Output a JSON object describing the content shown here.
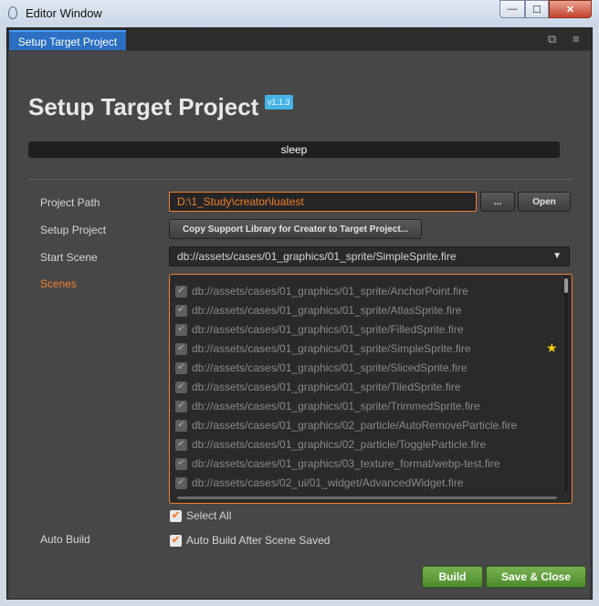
{
  "window": {
    "title": "Editor Window",
    "min_glyph": "—",
    "max_glyph": "☐",
    "close_glyph": "✕"
  },
  "tab": {
    "label": "Setup Target Project"
  },
  "header": {
    "title": "Setup Target Project",
    "version": "v1.1.3"
  },
  "status": {
    "text": "sleep"
  },
  "labels": {
    "project_path": "Project Path",
    "setup_project": "Setup Project",
    "start_scene": "Start Scene",
    "scenes": "Scenes",
    "auto_build": "Auto Build"
  },
  "project_path": {
    "value": "D:\\1_Study\\creator\\luatest",
    "browse_label": "...",
    "open_label": "Open"
  },
  "setup": {
    "button_label": "Copy Support Library for Creator to Target Project..."
  },
  "start_scene": {
    "value": "db://assets/cases/01_graphics/01_sprite/SimpleSprite.fire"
  },
  "scenes": [
    "db://assets/cases/01_graphics/01_sprite/AnchorPoint.fire",
    "db://assets/cases/01_graphics/01_sprite/AtlasSprite.fire",
    "db://assets/cases/01_graphics/01_sprite/FilledSprite.fire",
    "db://assets/cases/01_graphics/01_sprite/SimpleSprite.fire",
    "db://assets/cases/01_graphics/01_sprite/SlicedSprite.fire",
    "db://assets/cases/01_graphics/01_sprite/TiledSprite.fire",
    "db://assets/cases/01_graphics/01_sprite/TrimmedSprite.fire",
    "db://assets/cases/01_graphics/02_particle/AutoRemoveParticle.fire",
    "db://assets/cases/01_graphics/02_particle/ToggleParticle.fire",
    "db://assets/cases/01_graphics/03_texture_format/webp-test.fire",
    "db://assets/cases/02_ui/01_widget/AdvancedWidget.fire"
  ],
  "select_all": {
    "label": "Select All",
    "checked": true
  },
  "auto_build_option": {
    "label": "Auto Build After Scene Saved",
    "checked": true
  },
  "footer": {
    "build_label": "Build",
    "save_close_label": "Save & Close"
  },
  "colors": {
    "accent": "#f0802f",
    "tab_blue": "#2a6fc2",
    "version_badge": "#46b3e6",
    "green_button": "#5c9a38",
    "star": "#f5d000"
  }
}
